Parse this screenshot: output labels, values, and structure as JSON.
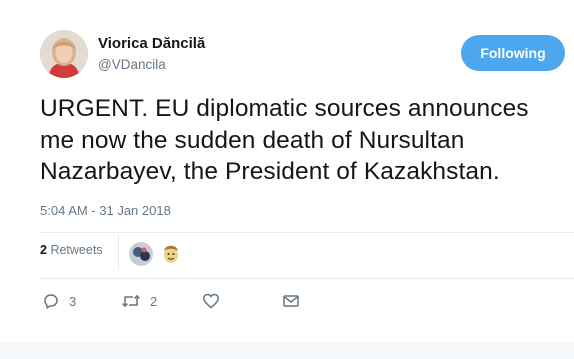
{
  "author": {
    "name": "Viorica Dăncilă",
    "handle": "@VDancila"
  },
  "follow_button": {
    "label": "Following"
  },
  "tweet": {
    "text_lines": [
      "URGENT. EU diplomatic sources announces",
      "me now the sudden death of Nursultan",
      "Nazarbayev, the President of Kazakhstan."
    ],
    "timestamp": "5:04 AM - 31 Jan 2018"
  },
  "stats": {
    "retweet_count": "2",
    "retweet_label": "Retweets"
  },
  "actions": {
    "reply": {
      "icon": "reply-icon",
      "count": "3"
    },
    "retweet": {
      "icon": "retweet-icon",
      "count": "2"
    },
    "like": {
      "icon": "heart-icon",
      "count": ""
    },
    "message": {
      "icon": "envelope-icon"
    }
  },
  "colors": {
    "accent": "#4da7ee",
    "secondary_text": "#657786",
    "divider": "#e6ecf0"
  }
}
